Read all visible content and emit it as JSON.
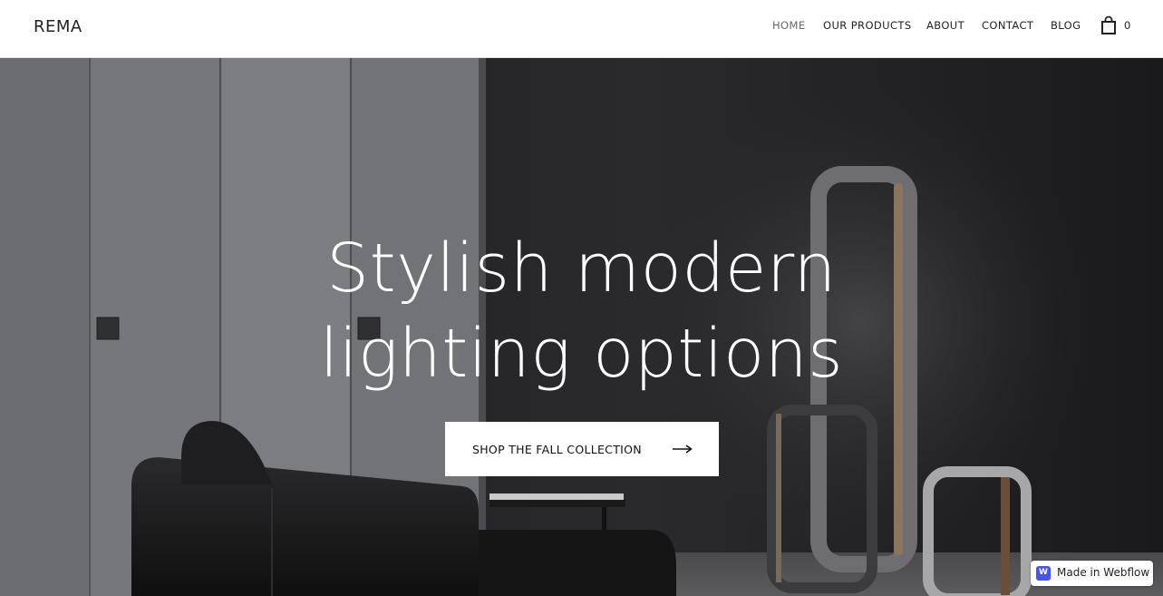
{
  "brand": {
    "name": "REMA"
  },
  "nav": {
    "items": [
      {
        "label": "HOME",
        "current": true
      },
      {
        "label": "OUR PRODUCTS",
        "current": false
      },
      {
        "label": "ABOUT",
        "current": false
      },
      {
        "label": "CONTACT",
        "current": false
      },
      {
        "label": "BLOG",
        "current": false
      }
    ],
    "cart": {
      "icon": "shopping-bag-icon",
      "count": "0"
    }
  },
  "hero": {
    "title_line_1": "Stylish modern",
    "title_line_2": "lighting options",
    "cta": {
      "label": "SHOP THE FALL COLLECTION",
      "icon": "arrow-right-icon"
    }
  },
  "webflow_badge": {
    "label": "Made in Webflow",
    "icon": "webflow-logo-icon"
  },
  "colors": {
    "header_bg": "#ffffff",
    "nav_text": "#222222",
    "nav_current": "#6a6a6a",
    "hero_text": "#ffffff",
    "cta_bg": "#ffffff",
    "webflow_brand": "#4353ff"
  }
}
